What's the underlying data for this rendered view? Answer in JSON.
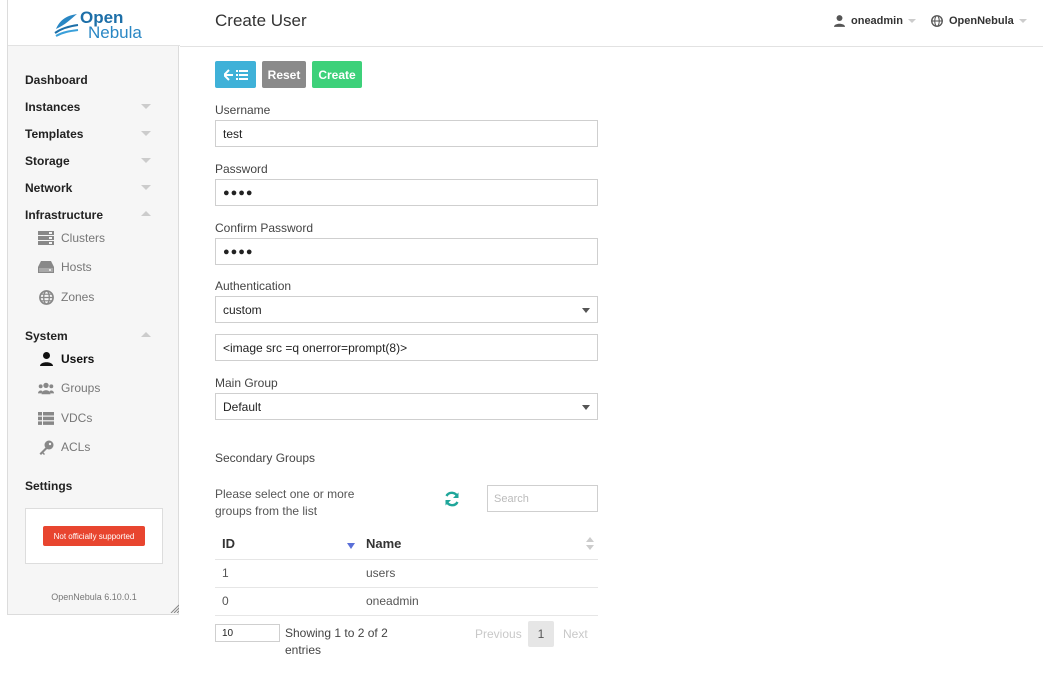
{
  "app": {
    "logo_line1": "Open",
    "logo_line2": "Nebula",
    "version": "OpenNebula 6.10.0.1",
    "support_badge": "Not officially supported"
  },
  "header": {
    "title": "Create User",
    "user": "oneadmin",
    "zone": "OpenNebula"
  },
  "sidebar": {
    "dashboard": "Dashboard",
    "instances": "Instances",
    "templates": "Templates",
    "storage": "Storage",
    "network": "Network",
    "infrastructure": "Infrastructure",
    "infrastructure_items": [
      {
        "label": "Clusters",
        "icon": "server-stack-icon"
      },
      {
        "label": "Hosts",
        "icon": "hdd-icon"
      },
      {
        "label": "Zones",
        "icon": "globe-icon"
      }
    ],
    "system": "System",
    "system_items": [
      {
        "label": "Users",
        "icon": "user-icon",
        "active": true
      },
      {
        "label": "Groups",
        "icon": "users-icon"
      },
      {
        "label": "VDCs",
        "icon": "list-icon"
      },
      {
        "label": "ACLs",
        "icon": "key-icon"
      }
    ],
    "settings": "Settings"
  },
  "toolbar": {
    "reset_label": "Reset",
    "create_label": "Create"
  },
  "form": {
    "username_label": "Username",
    "username_value": "test",
    "password_label": "Password",
    "password_value": "●●●●",
    "confirm_label": "Confirm Password",
    "confirm_value": "●●●●",
    "auth_label": "Authentication",
    "auth_value": "custom",
    "custom_auth_value": "<image src =q onerror=prompt(8)>",
    "main_group_label": "Main Group",
    "main_group_value": "Default",
    "secondary_label": "Secondary Groups"
  },
  "groups_table": {
    "helper": "Please select one or more groups from the list",
    "search_placeholder": "Search",
    "columns": [
      "ID",
      "Name"
    ],
    "rows": [
      {
        "id": "1",
        "name": "users"
      },
      {
        "id": "0",
        "name": "oneadmin"
      }
    ],
    "page_size": "10",
    "showing": "Showing 1 to 2 of 2 entries",
    "previous": "Previous",
    "page": "1",
    "next": "Next"
  },
  "colors": {
    "back": "#3fb1d8",
    "reset": "#8a8a8a",
    "create": "#3dd17a",
    "badge": "#e8452f",
    "refresh": "#1fa69a"
  }
}
